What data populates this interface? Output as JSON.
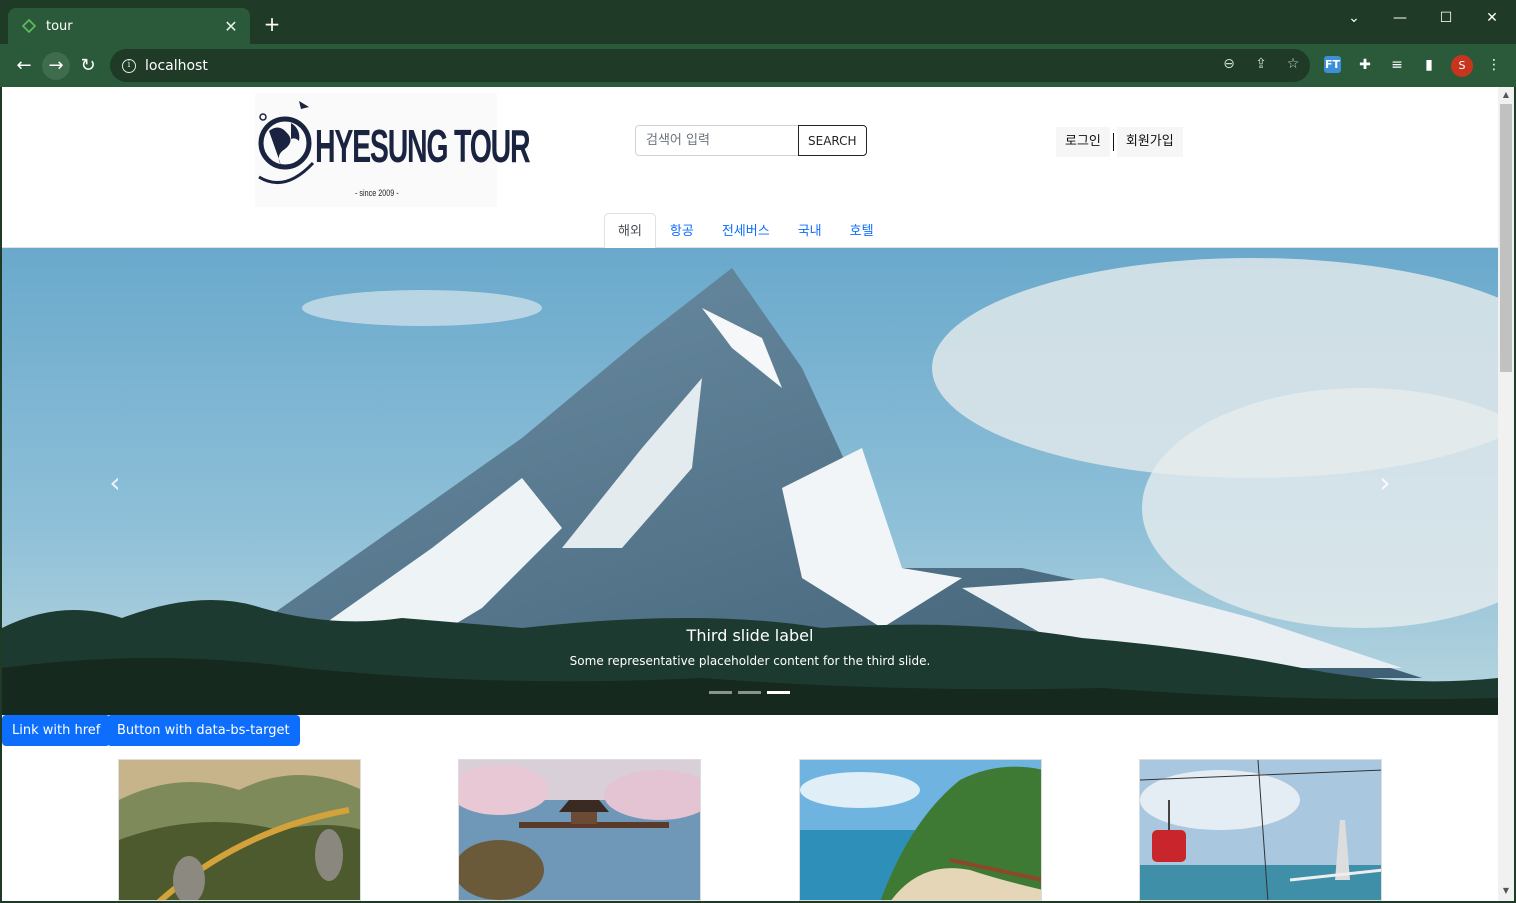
{
  "browser": {
    "tab_title": "tour",
    "tab_close": "✕",
    "new_tab": "+",
    "url": "localhost",
    "window": {
      "minimize": "—",
      "maximize": "☐",
      "close": "✕",
      "tab_search": "⌄"
    },
    "extension_ft_label": "FT",
    "profile_initial": "S"
  },
  "header": {
    "logo_text": "HYESUNG TOUR",
    "logo_since": "- since 2009 -",
    "search": {
      "placeholder": "검색어 입력",
      "button": "SEARCH"
    },
    "auth": {
      "login": "로그인",
      "signup": "회원가입"
    }
  },
  "nav": {
    "tabs": [
      {
        "label": "해외",
        "active": true
      },
      {
        "label": "항공"
      },
      {
        "label": "전세버스"
      },
      {
        "label": "국내"
      },
      {
        "label": "호텔"
      }
    ]
  },
  "carousel": {
    "caption_title": "Third slide label",
    "caption_text": "Some representative placeholder content for the third slide.",
    "prev_icon": "chevron-left-icon",
    "next_icon": "chevron-right-icon",
    "indicator_count": 3,
    "active_indicator": 3
  },
  "buttons": {
    "link_href": "Link with href",
    "data_bs_target": "Button with data-bs-target"
  },
  "colors": {
    "chrome_dark": "#1f3a26",
    "chrome_toolbar": "#2b5a3b",
    "primary": "#0d6efd",
    "link": "#0d6efd"
  }
}
